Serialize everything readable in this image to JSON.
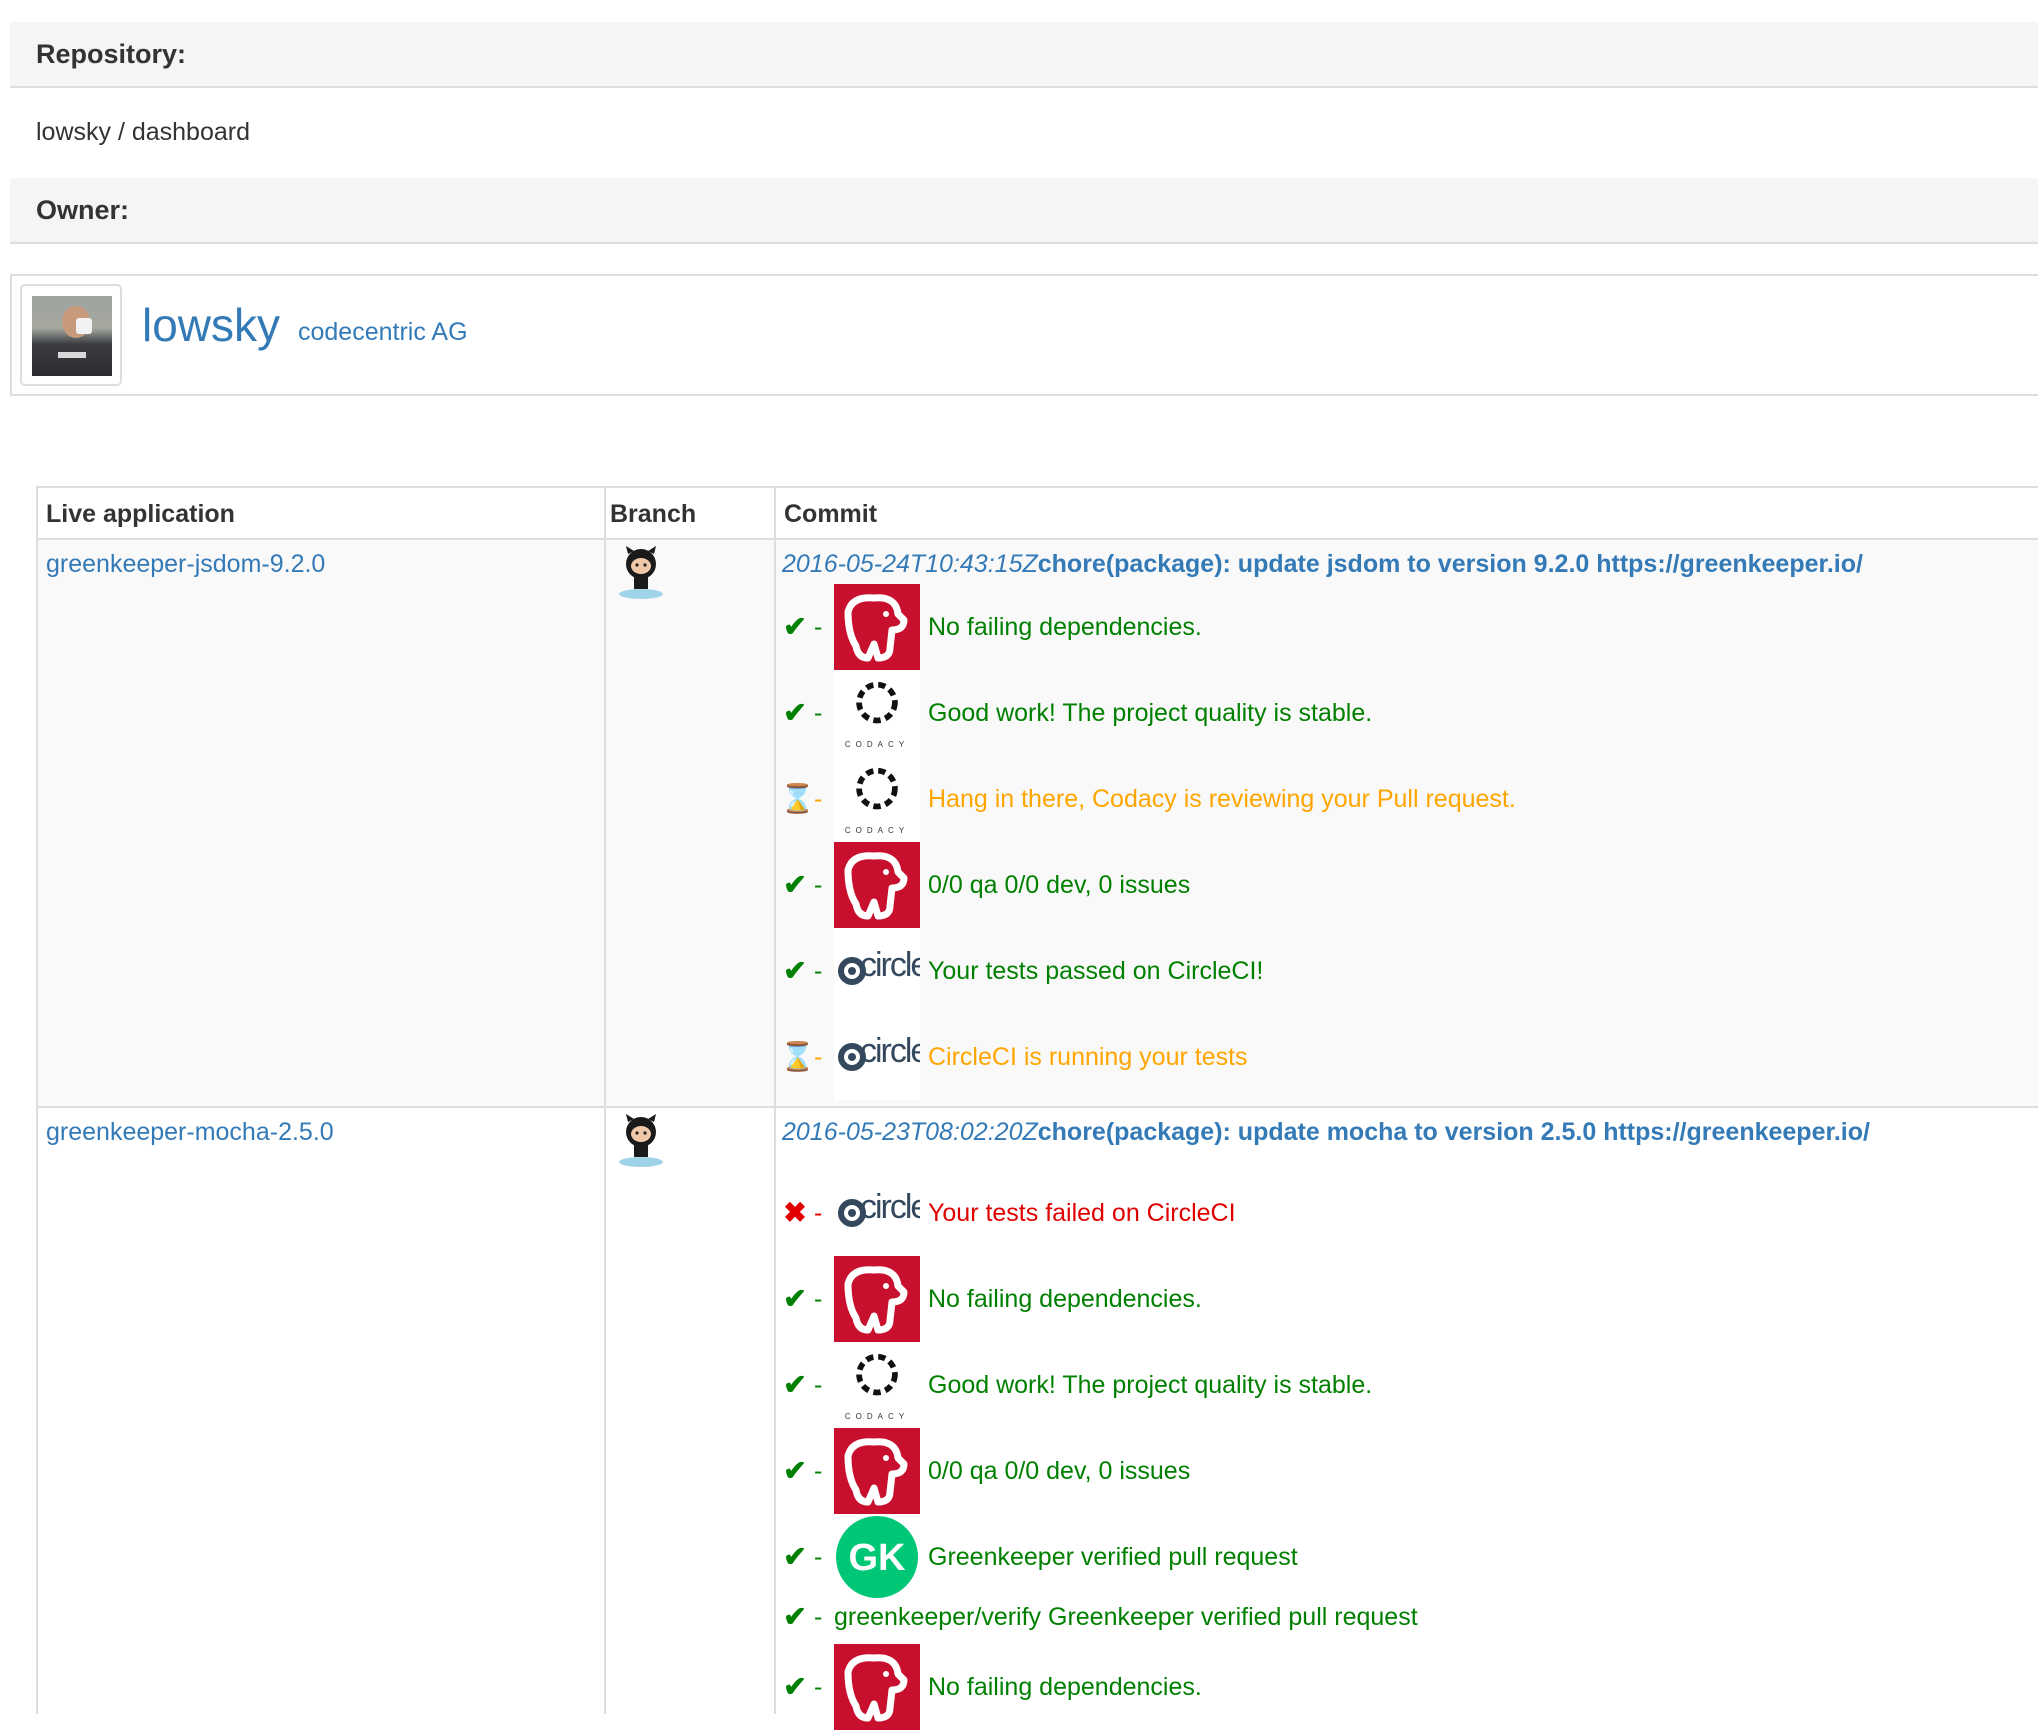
{
  "repository": {
    "heading": "Repository:",
    "name": "lowsky / dashboard"
  },
  "owner": {
    "heading": "Owner:",
    "login": "lowsky",
    "company": "codecentric AG"
  },
  "table": {
    "headers": {
      "live_application": "Live application",
      "branch": "Branch",
      "commit": "Commit"
    },
    "rows": [
      {
        "app": "greenkeeper-jsdom-9.2.0",
        "commit_date": "2016-05-24T10:43:15Z",
        "commit_message": "chore(package): update jsdom to version 9.2.0 https://greenkeeper.io/",
        "statuses": [
          {
            "state": "success",
            "logo": "gemnasium-logo",
            "text": "No failing dependencies."
          },
          {
            "state": "success",
            "logo": "codacy-logo",
            "text": "Good work! The project quality is stable."
          },
          {
            "state": "pending",
            "logo": "codacy-logo",
            "text": "Hang in there, Codacy is reviewing your Pull request."
          },
          {
            "state": "success",
            "logo": "gemnasium-logo",
            "text": "0/0 qa 0/0 dev, 0 issues"
          },
          {
            "state": "success",
            "logo": "circleci-logo",
            "text": "Your tests passed on CircleCI!"
          },
          {
            "state": "pending",
            "logo": "circleci-logo",
            "text": "CircleCI is running your tests"
          }
        ]
      },
      {
        "app": "greenkeeper-mocha-2.5.0",
        "commit_date": "2016-05-23T08:02:20Z",
        "commit_message": "chore(package): update mocha to version 2.5.0 https://greenkeeper.io/",
        "statuses": [
          {
            "state": "failure",
            "logo": "circleci-logo",
            "text": "Your tests failed on CircleCI"
          },
          {
            "state": "success",
            "logo": "gemnasium-logo",
            "text": "No failing dependencies."
          },
          {
            "state": "success",
            "logo": "codacy-logo",
            "text": "Good work! The project quality is stable."
          },
          {
            "state": "success",
            "logo": "gemnasium-logo",
            "text": "0/0 qa 0/0 dev, 0 issues"
          },
          {
            "state": "success",
            "logo": "greenkeeper-logo",
            "text": "Greenkeeper verified pull request"
          },
          {
            "state": "success",
            "logo": "",
            "text": "greenkeeper/verify Greenkeeper verified pull request"
          },
          {
            "state": "success",
            "logo": "gemnasium-logo",
            "text": "No failing dependencies."
          }
        ]
      }
    ]
  },
  "logo_text": {
    "circleci": "circleci",
    "codacy": "CODACY",
    "greenkeeper": "GK"
  },
  "status_separator": "-",
  "state_glyphs": {
    "success": "✔",
    "pending": "⌛",
    "failure": "✖"
  },
  "colors": {
    "link": "#337ab7",
    "success": "#008000",
    "pending": "#ffa500",
    "failure": "#e00000",
    "gemnasium": "#c8102e",
    "greenkeeper": "#00c775"
  }
}
